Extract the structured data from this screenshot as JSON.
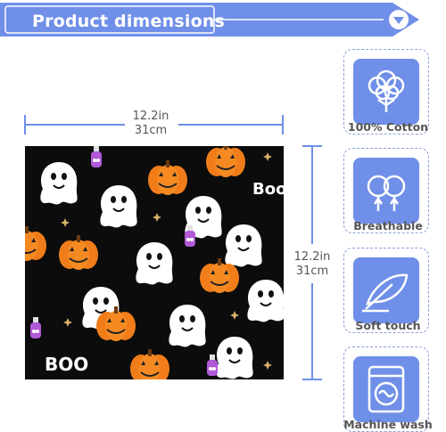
{
  "banner": {
    "title": "Product dimensions",
    "icon": "chevron-down-icon"
  },
  "dimensions": {
    "width_in": "12.2in",
    "width_cm": "31cm",
    "height_in": "12.2in",
    "height_cm": "31cm"
  },
  "pattern": {
    "boo_text": "BOO",
    "boo_text_small": "Boo"
  },
  "features": [
    {
      "label": "100% Cotton",
      "icon": "cotton-icon"
    },
    {
      "label": "Breathable",
      "icon": "breathable-trees-icon"
    },
    {
      "label": "Soft touch",
      "icon": "feather-icon"
    },
    {
      "label": "Machine wash",
      "icon": "washing-machine-icon"
    }
  ],
  "colors": {
    "accent": "#6f8fe8",
    "banner": "#6f8fe8",
    "pattern_bg": "#0c0c0c",
    "pumpkin": "#f07d1a"
  }
}
